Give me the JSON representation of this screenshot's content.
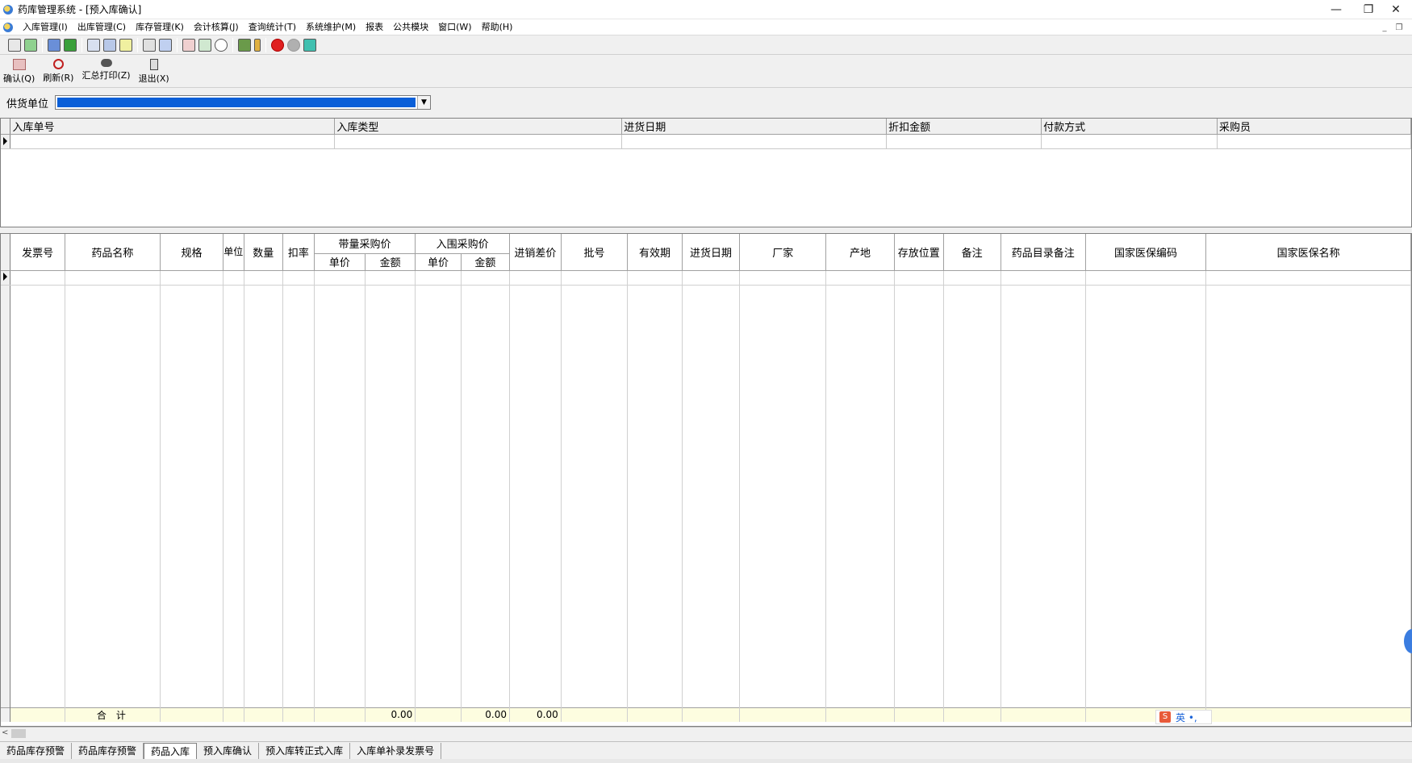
{
  "window": {
    "title": "药库管理系统 - [预入库确认]",
    "minimize": "—",
    "restore": "❐",
    "close": "✕"
  },
  "menu": {
    "items": [
      "入库管理(I)",
      "出库管理(C)",
      "库存管理(K)",
      "会计核算(J)",
      "查询统计(T)",
      "系统维护(M)",
      "报表",
      "公共模块",
      "窗口(W)",
      "帮助(H)"
    ],
    "mdi_minimize": "_",
    "mdi_restore": "❐"
  },
  "toolbar_icons": [
    "doc-icon",
    "refresh-icon",
    "book-icon",
    "check-icon",
    "page-icon",
    "image-icon",
    "list-icon",
    "copy-icon",
    "grid-icon",
    "report-icon",
    "chart-icon",
    "search-icon",
    "printer-icon",
    "thermometer-icon",
    "stop-icon",
    "disabled-icon",
    "close-box-icon"
  ],
  "actions": [
    {
      "label": "确认(Q)",
      "icon": "confirm-icon"
    },
    {
      "label": "刷新(R)",
      "icon": "refresh-icon"
    },
    {
      "label": "汇总打印(Z)",
      "icon": "binoculars-icon"
    },
    {
      "label": "退出(X)",
      "icon": "exit-icon"
    }
  ],
  "supplier": {
    "label": "供货单位",
    "value": ""
  },
  "master_grid": {
    "columns": [
      "入库单号",
      "入库类型",
      "进货日期",
      "折扣金额",
      "付款方式",
      "采购员"
    ]
  },
  "detail_grid": {
    "columns": [
      "发票号",
      "药品名称",
      "规格",
      "单位",
      "数量",
      "扣率",
      "带量采购价",
      "入围采购价",
      "进销差价",
      "批号",
      "有效期",
      "进货日期",
      "厂家",
      "产地",
      "存放位置",
      "备注",
      "药品目录备注",
      "国家医保编码",
      "国家医保名称"
    ],
    "sub_columns": {
      "unit_price": "单价",
      "amount": "金额"
    },
    "totals": {
      "label": "合　计",
      "bulk_amount": "0.00",
      "shortlist_amount": "0.00",
      "price_diff": "0.00"
    }
  },
  "tabs": [
    "药品库存预警",
    "药品库存预警",
    "药品入库",
    "预入库确认",
    "预入库转正式入库",
    "入库单补录发票号"
  ],
  "active_tab": 2,
  "ime": {
    "icon": "S",
    "text": "英 •,"
  }
}
